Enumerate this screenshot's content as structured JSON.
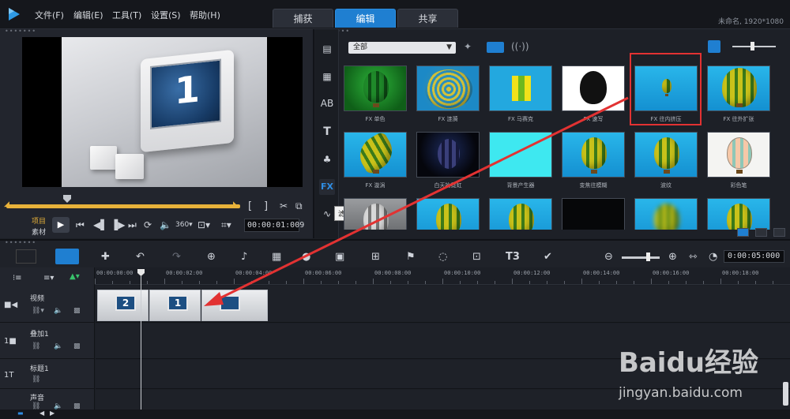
{
  "app": {
    "project_info": "未命名, 1920*1080"
  },
  "menu": [
    "文件(F)",
    "编辑(E)",
    "工具(T)",
    "设置(S)",
    "帮助(H)"
  ],
  "tabs": [
    {
      "label": "捕获",
      "active": false
    },
    {
      "label": "编辑",
      "active": true
    },
    {
      "label": "共享",
      "active": false
    }
  ],
  "preview": {
    "screen_number": "1",
    "mode_project": "项目",
    "mode_clip": "素材",
    "timecode": "00:00:01:009"
  },
  "library": {
    "category": "全部",
    "tooltip": "滤镜",
    "items": [
      {
        "label": "FX 单色",
        "style": "green"
      },
      {
        "label": "FX 涟漪",
        "style": "ripple"
      },
      {
        "label": "FX 马赛克",
        "style": "mosaic"
      },
      {
        "label": "FX 速写",
        "style": "sketch"
      },
      {
        "label": "FX 往内挤压",
        "style": "pinch",
        "selected": true
      },
      {
        "label": "FX 往外扩张",
        "style": "bulge"
      },
      {
        "label": "FX 漩涡",
        "style": "swirl"
      },
      {
        "label": "白天抬霓虹",
        "style": "night"
      },
      {
        "label": "背景产生器",
        "style": "cyan"
      },
      {
        "label": "变焦往模糊",
        "style": "balloon"
      },
      {
        "label": "波纹",
        "style": "balloon"
      },
      {
        "label": "彩色笔",
        "style": "pencil"
      },
      {
        "label": "",
        "style": "grey"
      },
      {
        "label": "",
        "style": "balloon"
      },
      {
        "label": "",
        "style": "balloon"
      },
      {
        "label": "",
        "style": "dark"
      },
      {
        "label": "",
        "style": "blur"
      },
      {
        "label": "",
        "style": "balloon"
      }
    ]
  },
  "timeline": {
    "duration": "0:00:05:000",
    "ruler": [
      "00:00:00:00",
      "00:00:02:00",
      "00:00:04:00",
      "00:00:06:00",
      "00:00:08:00",
      "00:00:10:00",
      "00:00:12:00",
      "00:00:14:00",
      "00:00:16:00",
      "00:00:18:00"
    ],
    "tracks": [
      {
        "name": "视频",
        "kind": "video"
      },
      {
        "name": "叠加1",
        "kind": "overlay"
      },
      {
        "name": "标题1",
        "kind": "title"
      },
      {
        "name": "声音",
        "kind": "audio"
      }
    ],
    "clips": [
      {
        "number": "2"
      },
      {
        "number": "1"
      },
      {
        "number": ""
      }
    ]
  },
  "watermark": {
    "brand": "Baidu经验",
    "url": "jingyan.baidu.com"
  },
  "colors": {
    "accent": "#1f7fd1",
    "highlight_box": "#e23232",
    "scrubber": "#e8b23a"
  }
}
